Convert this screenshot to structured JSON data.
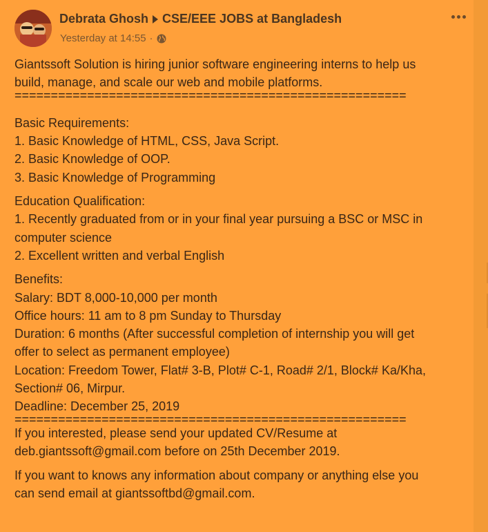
{
  "post": {
    "author": "Debrata Ghosh",
    "group": "CSE/EEE JOBS at Bangladesh",
    "timestamp": "Yesterday at 14:55",
    "meta_separator": "·",
    "privacy_icon": "globe-icon",
    "more_icon": "more-options-icon",
    "lines": [
      "Giantssoft Solution is hiring junior software engineering interns to help us",
      "build, manage, and scale our web and mobile platforms.",
      "======================================================",
      "",
      "Basic Requirements:",
      "1. Basic Knowledge of HTML, CSS, Java Script.",
      "2. Basic Knowledge of OOP.",
      "3. Basic Knowledge of Programming",
      "Education Qualification:",
      "1. Recently graduated from or in your final year pursuing a BSC or MSC in",
      "computer science",
      "2. Excellent written and verbal English",
      "Benefits:",
      "Salary: BDT 8,000-10,000 per month",
      "Office hours: 11 am to 8 pm Sunday to Thursday",
      "Duration: 6 months (After successful completion of internship you will get",
      "offer to select as permanent employee)",
      "Location: Freedom Tower, Flat# 3-B, Plot# C-1, Road# 2/1, Block# Ka/Kha,",
      "Section# 06, Mirpur.",
      "Deadline: December 25, 2019",
      "======================================================",
      "If you interested, please send your updated CV/Resume at",
      "deb.giantssoft@gmail.com before on 25th December 2019.",
      "If you want to knows any information about company or anything else you",
      "can send email at giantssoftbd@gmail.com."
    ]
  },
  "colors": {
    "card_bg": "#ffa03a",
    "page_bg": "#f39a35",
    "text": "#3a2616"
  }
}
